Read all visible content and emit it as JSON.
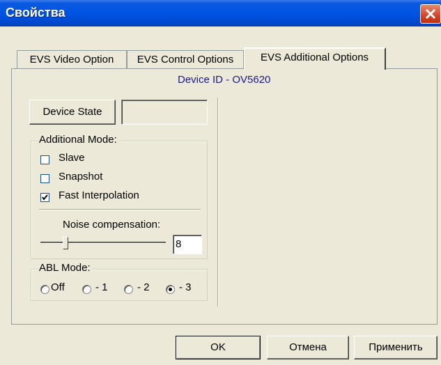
{
  "window": {
    "title": "Свойства"
  },
  "tabs": [
    {
      "label": "EVS Video Option"
    },
    {
      "label": "EVS Control Options"
    },
    {
      "label": "EVS Additional Options"
    }
  ],
  "device_id": "Device ID - OV5620",
  "device_state": {
    "button_label": "Device State",
    "value": ""
  },
  "additional_mode": {
    "label": "Additional Mode:",
    "options": [
      {
        "label": "Slave",
        "checked": false
      },
      {
        "label": "Snapshot",
        "checked": false
      },
      {
        "label": "Fast Interpolation",
        "checked": true
      }
    ],
    "noise_label": "Noise compensation:",
    "noise_value": "8"
  },
  "abl_mode": {
    "label": "ABL Mode:",
    "options": [
      {
        "label": "Off",
        "selected": false
      },
      {
        "label": "- 1",
        "selected": false
      },
      {
        "label": "- 2",
        "selected": false
      },
      {
        "label": "- 3",
        "selected": true
      }
    ]
  },
  "buttons": {
    "ok": "OK",
    "cancel": "Отмена",
    "apply": "Применить"
  }
}
